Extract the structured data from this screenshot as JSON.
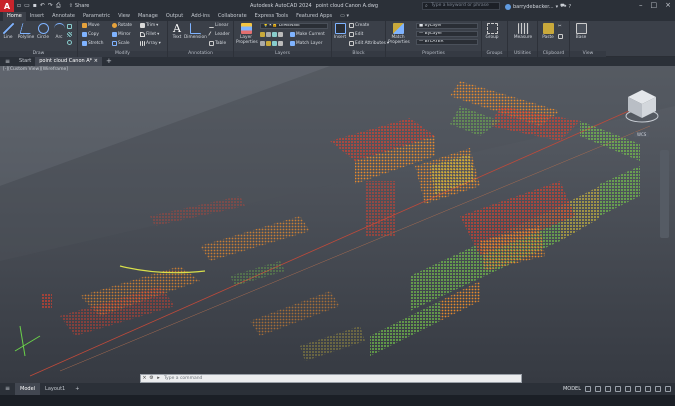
{
  "app": {
    "logo": "A",
    "title": "Autodesk AutoCAD 2024",
    "file": "point cloud Canon A.dwg",
    "share_label": "Share",
    "search_placeholder": "Type a keyword or phrase",
    "user_name": "barrydebacker...",
    "brand_color": "#c8242b"
  },
  "ribbon_tabs": [
    "Home",
    "Insert",
    "Annotate",
    "Parametric",
    "View",
    "Manage",
    "Output",
    "Add-ins",
    "Collaborate",
    "Express Tools",
    "Featured Apps"
  ],
  "ribbon": {
    "draw": {
      "title": "Draw",
      "line": "Line",
      "polyline": "Polyline",
      "circle": "Circle",
      "arc": "Arc"
    },
    "modify": {
      "title": "Modify",
      "move": "Move",
      "rotate": "Rotate",
      "trim": "Trim",
      "copy": "Copy",
      "mirror": "Mirror",
      "fillet": "Fillet",
      "stretch": "Stretch",
      "scale": "Scale",
      "array": "Array"
    },
    "annotation": {
      "title": "Annotation",
      "text": "Text",
      "dimension": "Dimension",
      "linear": "Linear",
      "leader": "Leader",
      "table": "Table"
    },
    "layers": {
      "title": "Layers",
      "layer_properties": "Layer Properties",
      "current_layer": "DIMENSIE",
      "make_current": "Make Current",
      "match_layer": "Match Layer"
    },
    "block": {
      "title": "Block",
      "insert": "Insert",
      "create": "Create",
      "edit": "Edit",
      "edit_attributes": "Edit Attributes"
    },
    "properties": {
      "title": "Properties",
      "match": "Match Properties",
      "color": "ByLayer",
      "linetype": "ByLayer",
      "lineweight": "BYLAYER"
    },
    "groups": {
      "title": "Groups",
      "group": "Group"
    },
    "utilities": {
      "title": "Utilities",
      "measure": "Measure"
    },
    "clipboard": {
      "title": "Clipboard",
      "paste": "Paste"
    },
    "view": {
      "title": "View",
      "base": "Base"
    }
  },
  "file_tabs": {
    "start": "Start",
    "drawing": "point cloud Canon A*"
  },
  "viewport": {
    "label": "[-][Custom View][Wireframe]",
    "wcs": "WCS"
  },
  "command_line": {
    "prompt": "Type a command"
  },
  "status_bar": {
    "model_tab": "Model",
    "layout_tab": "Layout1",
    "model_button": "MODEL"
  }
}
